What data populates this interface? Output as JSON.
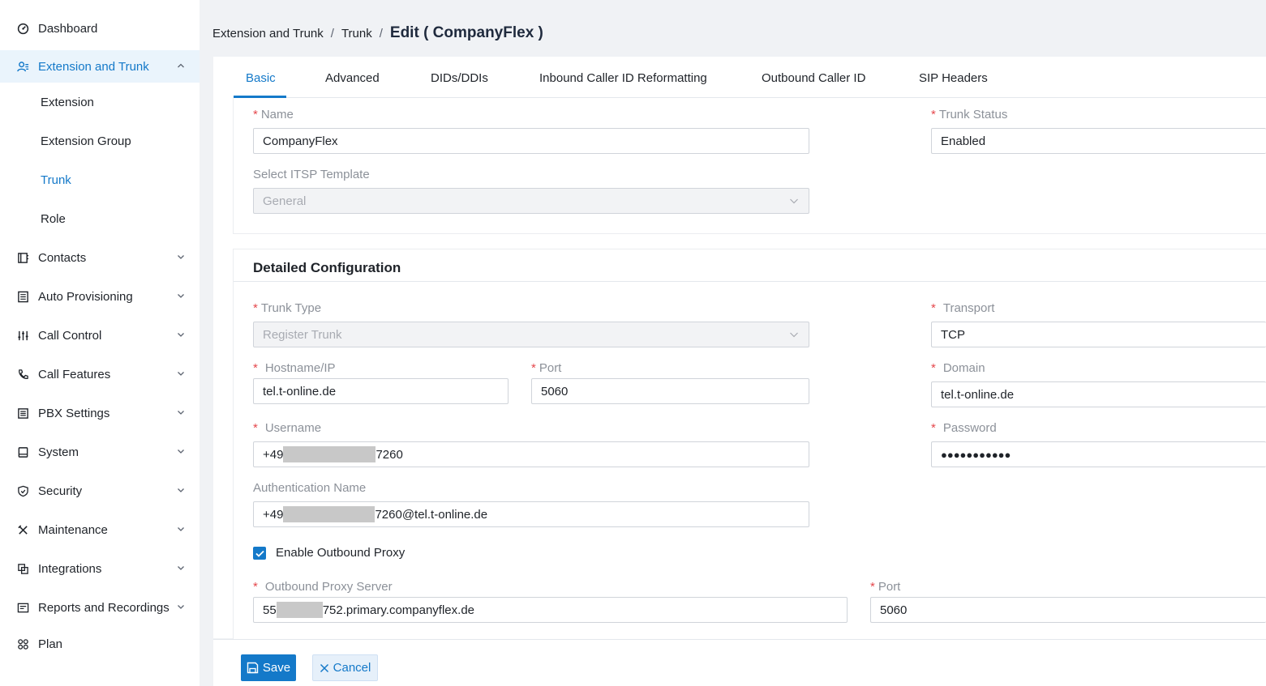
{
  "sidebar": {
    "items": [
      {
        "label": "Dashboard",
        "icon": "dashboard-icon"
      },
      {
        "label": "Extension and Trunk",
        "icon": "users-icon",
        "expanded": true
      },
      {
        "label": "Contacts",
        "icon": "contacts-icon"
      },
      {
        "label": "Auto Provisioning",
        "icon": "provisioning-icon"
      },
      {
        "label": "Call Control",
        "icon": "sliders-icon"
      },
      {
        "label": "Call Features",
        "icon": "phone-icon"
      },
      {
        "label": "PBX Settings",
        "icon": "list-icon"
      },
      {
        "label": "System",
        "icon": "system-icon"
      },
      {
        "label": "Security",
        "icon": "shield-icon"
      },
      {
        "label": "Maintenance",
        "icon": "tools-icon"
      },
      {
        "label": "Integrations",
        "icon": "integrations-icon"
      },
      {
        "label": "Reports and Recordings",
        "icon": "reports-icon"
      },
      {
        "label": "Plan",
        "icon": "plan-icon"
      }
    ],
    "subitems": [
      {
        "label": "Extension"
      },
      {
        "label": "Extension Group"
      },
      {
        "label": "Trunk",
        "active": true
      },
      {
        "label": "Role"
      }
    ]
  },
  "breadcrumb": {
    "level1": "Extension and Trunk",
    "level2": "Trunk",
    "sep": "/",
    "current": "Edit ( CompanyFlex )"
  },
  "tabs": [
    {
      "label": "Basic",
      "active": true
    },
    {
      "label": "Advanced"
    },
    {
      "label": "DIDs/DDIs"
    },
    {
      "label": "Inbound Caller ID Reformatting"
    },
    {
      "label": "Outbound Caller ID"
    },
    {
      "label": "SIP Headers"
    }
  ],
  "basic": {
    "name_label": "Name",
    "name_value": "CompanyFlex",
    "trunk_status_label": "Trunk Status",
    "trunk_status_value": "Enabled",
    "itsp_label": "Select ITSP Template",
    "itsp_value": "General"
  },
  "detailed": {
    "title": "Detailed Configuration",
    "trunk_type_label": "Trunk Type",
    "trunk_type_value": "Register Trunk",
    "transport_label": "Transport",
    "transport_value": "TCP",
    "hostname_label": "Hostname/IP",
    "hostname_value": "tel.t-online.de",
    "port_label": "Port",
    "port_value": "5060",
    "domain_label": "Domain",
    "domain_value": "tel.t-online.de",
    "username_label": "Username",
    "username_prefix": "+49",
    "username_suffix": "7260",
    "password_label": "Password",
    "password_value": "●●●●●●●●●●●",
    "auth_label": "Authentication Name",
    "auth_prefix": "+49",
    "auth_suffix": "7260@tel.t-online.de",
    "outbound_proxy_checkbox": "Enable Outbound Proxy",
    "outbound_proxy_checked": true,
    "proxy_server_label": "Outbound Proxy Server",
    "proxy_server_prefix": "55",
    "proxy_server_suffix": "752.primary.companyflex.de",
    "proxy_port_label": "Port",
    "proxy_port_value": "5060"
  },
  "footer": {
    "save_label": "Save",
    "cancel_label": "Cancel"
  },
  "colors": {
    "accent": "#1479c9",
    "required": "#e5484d"
  }
}
